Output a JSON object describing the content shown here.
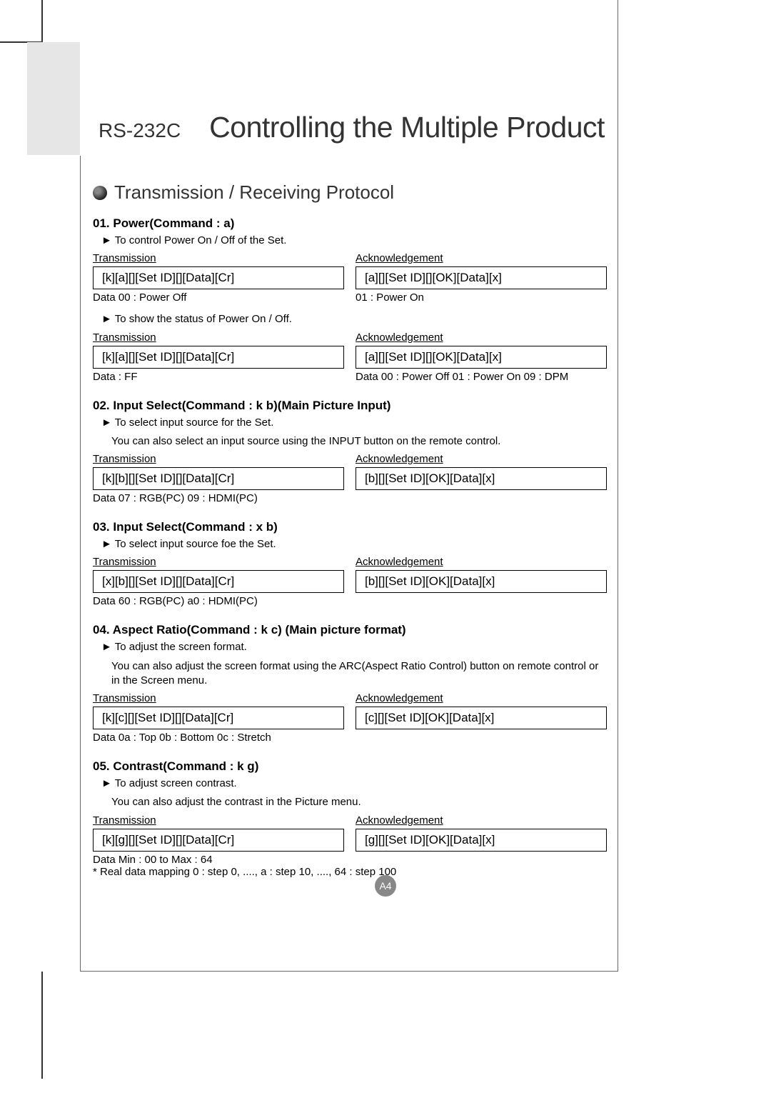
{
  "chapter_label": "RS-232C",
  "main_title": "Controlling the Multiple Product",
  "section_title": "Transmission / Receiving Protocol",
  "page_number": "A4",
  "labels": {
    "transmission": "Transmission",
    "acknowledgement": "Acknowledgement"
  },
  "commands": [
    {
      "title": "01. Power(Command : a)",
      "desc_lines": [
        "► To control Power On / Off of the Set."
      ],
      "rows": [
        {
          "tx": "[k][a][][Set ID][][Data][Cr]",
          "ack": "[a][][Set ID][][OK][Data][x]",
          "tx_note": "Data 00 : Power Off",
          "ack_note": "01 : Power On"
        }
      ],
      "extra_desc": "► To show the status of Power On / Off.",
      "rows2": [
        {
          "tx": "[k][a][][Set ID][][Data][Cr]",
          "ack": "[a][][Set ID][][OK][Data][x]",
          "tx_note": "Data : FF",
          "ack_note": "Data 00 : Power Off    01 : Power On    09 : DPM"
        }
      ]
    },
    {
      "title": "02. Input Select(Command : k b)(Main Picture Input)",
      "desc_lines": [
        "► To select input source for the Set.",
        "You can also select an input source using the INPUT button on the remote control."
      ],
      "rows": [
        {
          "tx": "[k][b][][Set ID][][Data][Cr]",
          "ack": "[b][][Set ID][OK][Data][x]",
          "tx_note": "Data 07 : RGB(PC)     09 : HDMI(PC)",
          "ack_note": ""
        }
      ]
    },
    {
      "title": "03. Input Select(Command : x b)",
      "desc_lines": [
        "► To select input source foe the Set."
      ],
      "rows": [
        {
          "tx": "[x][b][][Set ID][][Data][Cr]",
          "ack": "[b][][Set ID][OK][Data][x]",
          "tx_note": "Data 60 : RGB(PC)     a0 : HDMI(PC)",
          "ack_note": ""
        }
      ]
    },
    {
      "title": "04. Aspect Ratio(Command : k c) (Main picture format)",
      "desc_lines": [
        "► To adjust the screen format.",
        "You can also adjust the screen format using the ARC(Aspect Ratio Control) button on remote control or in the Screen menu."
      ],
      "rows": [
        {
          "tx": "[k][c][][Set ID][][Data][Cr]",
          "ack": "[c][][Set ID][OK][Data][x]",
          "tx_note": "Data 0a : Top    0b : Bottom    0c : Stretch",
          "ack_note": ""
        }
      ]
    },
    {
      "title": "05. Contrast(Command : k g)",
      "desc_lines": [
        "► To adjust screen contrast.",
        "You can also adjust the contrast in the Picture menu."
      ],
      "rows": [
        {
          "tx": "[k][g][][Set ID][][Data][Cr]",
          "ack": "[g][][Set ID][OK][Data][x]",
          "tx_note": "Data Min : 00 to Max : 64",
          "ack_note": ""
        }
      ],
      "footnote": "* Real data mapping 0 : step 0, ...., a : step 10, ...., 64 : step 100"
    }
  ]
}
